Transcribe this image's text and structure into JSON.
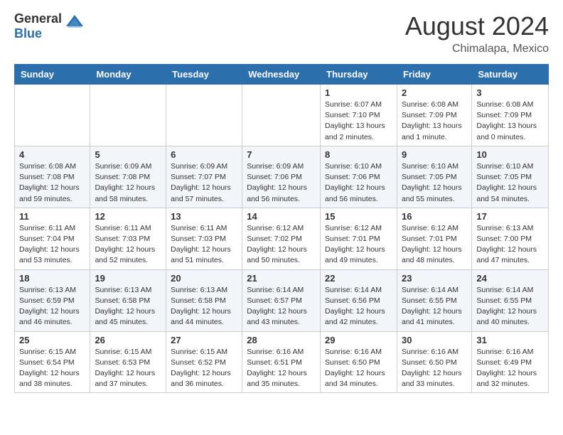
{
  "header": {
    "logo_line1": "General",
    "logo_line2": "Blue",
    "month_year": "August 2024",
    "location": "Chimalapa, Mexico"
  },
  "days_of_week": [
    "Sunday",
    "Monday",
    "Tuesday",
    "Wednesday",
    "Thursday",
    "Friday",
    "Saturday"
  ],
  "weeks": [
    [
      {
        "num": "",
        "info": ""
      },
      {
        "num": "",
        "info": ""
      },
      {
        "num": "",
        "info": ""
      },
      {
        "num": "",
        "info": ""
      },
      {
        "num": "1",
        "info": "Sunrise: 6:07 AM\nSunset: 7:10 PM\nDaylight: 13 hours\nand 2 minutes."
      },
      {
        "num": "2",
        "info": "Sunrise: 6:08 AM\nSunset: 7:09 PM\nDaylight: 13 hours\nand 1 minute."
      },
      {
        "num": "3",
        "info": "Sunrise: 6:08 AM\nSunset: 7:09 PM\nDaylight: 13 hours\nand 0 minutes."
      }
    ],
    [
      {
        "num": "4",
        "info": "Sunrise: 6:08 AM\nSunset: 7:08 PM\nDaylight: 12 hours\nand 59 minutes."
      },
      {
        "num": "5",
        "info": "Sunrise: 6:09 AM\nSunset: 7:08 PM\nDaylight: 12 hours\nand 58 minutes."
      },
      {
        "num": "6",
        "info": "Sunrise: 6:09 AM\nSunset: 7:07 PM\nDaylight: 12 hours\nand 57 minutes."
      },
      {
        "num": "7",
        "info": "Sunrise: 6:09 AM\nSunset: 7:06 PM\nDaylight: 12 hours\nand 56 minutes."
      },
      {
        "num": "8",
        "info": "Sunrise: 6:10 AM\nSunset: 7:06 PM\nDaylight: 12 hours\nand 56 minutes."
      },
      {
        "num": "9",
        "info": "Sunrise: 6:10 AM\nSunset: 7:05 PM\nDaylight: 12 hours\nand 55 minutes."
      },
      {
        "num": "10",
        "info": "Sunrise: 6:10 AM\nSunset: 7:05 PM\nDaylight: 12 hours\nand 54 minutes."
      }
    ],
    [
      {
        "num": "11",
        "info": "Sunrise: 6:11 AM\nSunset: 7:04 PM\nDaylight: 12 hours\nand 53 minutes."
      },
      {
        "num": "12",
        "info": "Sunrise: 6:11 AM\nSunset: 7:03 PM\nDaylight: 12 hours\nand 52 minutes."
      },
      {
        "num": "13",
        "info": "Sunrise: 6:11 AM\nSunset: 7:03 PM\nDaylight: 12 hours\nand 51 minutes."
      },
      {
        "num": "14",
        "info": "Sunrise: 6:12 AM\nSunset: 7:02 PM\nDaylight: 12 hours\nand 50 minutes."
      },
      {
        "num": "15",
        "info": "Sunrise: 6:12 AM\nSunset: 7:01 PM\nDaylight: 12 hours\nand 49 minutes."
      },
      {
        "num": "16",
        "info": "Sunrise: 6:12 AM\nSunset: 7:01 PM\nDaylight: 12 hours\nand 48 minutes."
      },
      {
        "num": "17",
        "info": "Sunrise: 6:13 AM\nSunset: 7:00 PM\nDaylight: 12 hours\nand 47 minutes."
      }
    ],
    [
      {
        "num": "18",
        "info": "Sunrise: 6:13 AM\nSunset: 6:59 PM\nDaylight: 12 hours\nand 46 minutes."
      },
      {
        "num": "19",
        "info": "Sunrise: 6:13 AM\nSunset: 6:58 PM\nDaylight: 12 hours\nand 45 minutes."
      },
      {
        "num": "20",
        "info": "Sunrise: 6:13 AM\nSunset: 6:58 PM\nDaylight: 12 hours\nand 44 minutes."
      },
      {
        "num": "21",
        "info": "Sunrise: 6:14 AM\nSunset: 6:57 PM\nDaylight: 12 hours\nand 43 minutes."
      },
      {
        "num": "22",
        "info": "Sunrise: 6:14 AM\nSunset: 6:56 PM\nDaylight: 12 hours\nand 42 minutes."
      },
      {
        "num": "23",
        "info": "Sunrise: 6:14 AM\nSunset: 6:55 PM\nDaylight: 12 hours\nand 41 minutes."
      },
      {
        "num": "24",
        "info": "Sunrise: 6:14 AM\nSunset: 6:55 PM\nDaylight: 12 hours\nand 40 minutes."
      }
    ],
    [
      {
        "num": "25",
        "info": "Sunrise: 6:15 AM\nSunset: 6:54 PM\nDaylight: 12 hours\nand 38 minutes."
      },
      {
        "num": "26",
        "info": "Sunrise: 6:15 AM\nSunset: 6:53 PM\nDaylight: 12 hours\nand 37 minutes."
      },
      {
        "num": "27",
        "info": "Sunrise: 6:15 AM\nSunset: 6:52 PM\nDaylight: 12 hours\nand 36 minutes."
      },
      {
        "num": "28",
        "info": "Sunrise: 6:16 AM\nSunset: 6:51 PM\nDaylight: 12 hours\nand 35 minutes."
      },
      {
        "num": "29",
        "info": "Sunrise: 6:16 AM\nSunset: 6:50 PM\nDaylight: 12 hours\nand 34 minutes."
      },
      {
        "num": "30",
        "info": "Sunrise: 6:16 AM\nSunset: 6:50 PM\nDaylight: 12 hours\nand 33 minutes."
      },
      {
        "num": "31",
        "info": "Sunrise: 6:16 AM\nSunset: 6:49 PM\nDaylight: 12 hours\nand 32 minutes."
      }
    ]
  ]
}
